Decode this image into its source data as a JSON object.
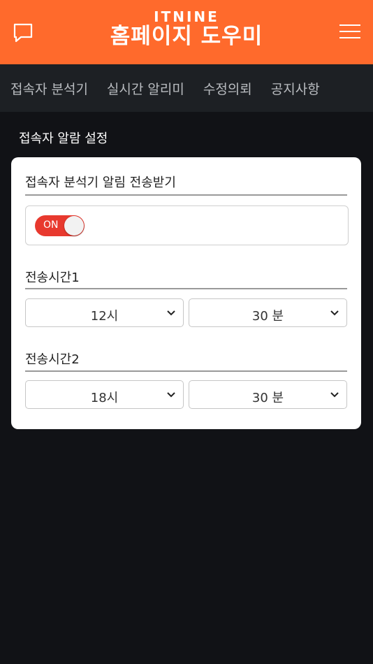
{
  "header": {
    "brand": "ITNINE",
    "title": "홈페이지 도우미",
    "chat_icon": "chat-bubble-icon",
    "menu_icon": "hamburger-menu-icon"
  },
  "tabs": [
    {
      "label": "접속자 분석기"
    },
    {
      "label": "실시간 알리미"
    },
    {
      "label": "수정의뢰"
    },
    {
      "label": "공지사항"
    }
  ],
  "section": {
    "title": "접속자 알람 설정"
  },
  "settings": {
    "notify_label": "접속자 분석기 알림 전송받기",
    "toggle": {
      "label": "ON",
      "state": "on"
    },
    "time1": {
      "label": "전송시간1",
      "hour": "12시",
      "minute": "30 분"
    },
    "time2": {
      "label": "전송시간2",
      "hour": "18시",
      "minute": "30 분"
    }
  },
  "colors": {
    "header_bg": "#ff6a2c",
    "tab_bar_bg": "#1d2024",
    "page_bg": "#111216",
    "toggle_on": "#e8392e"
  }
}
